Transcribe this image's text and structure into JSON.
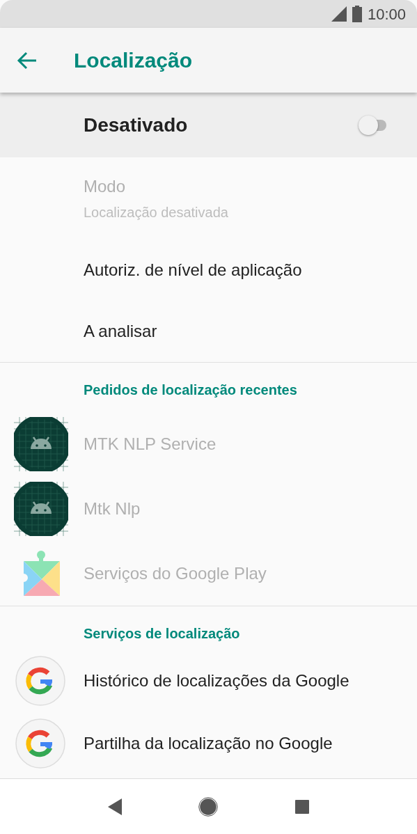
{
  "status_bar": {
    "time": "10:00"
  },
  "toolbar": {
    "title": "Localização"
  },
  "master_switch": {
    "label": "Desativado",
    "on": false
  },
  "settings": [
    {
      "title": "Modo",
      "summary": "Localização desativada",
      "disabled": true
    },
    {
      "title": "Autoriz. de nível de aplicação",
      "disabled": false
    },
    {
      "title": "A analisar",
      "disabled": false
    }
  ],
  "recent_requests": {
    "header": "Pedidos de localização recentes",
    "items": [
      {
        "kind": "android",
        "title": "MTK NLP Service",
        "disabled": true
      },
      {
        "kind": "android",
        "title": "Mtk Nlp",
        "disabled": true
      },
      {
        "kind": "puzzle",
        "title": "Serviços do Google Play",
        "disabled": true
      }
    ]
  },
  "location_services": {
    "header": "Serviços de localização",
    "items": [
      {
        "kind": "google",
        "title": "Histórico de localizações da Google"
      },
      {
        "kind": "google",
        "title": "Partilha da localização no Google"
      }
    ]
  }
}
